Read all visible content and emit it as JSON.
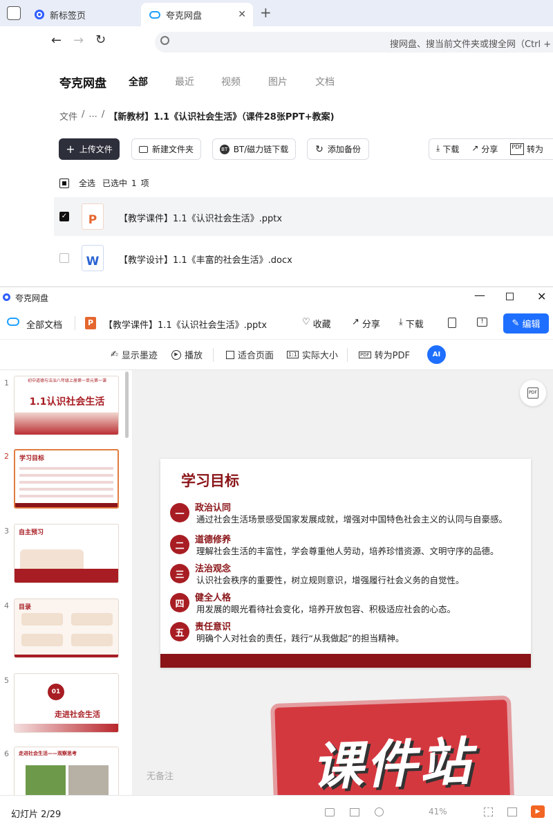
{
  "browser": {
    "tabs": [
      {
        "label": "新标签页"
      },
      {
        "label": "夸克网盘"
      }
    ],
    "new_tab_symbol": "+",
    "close_symbol": "✕",
    "address_placeholder": "搜网盘、搜当前文件夹或搜全网（Ctrl + F"
  },
  "drive": {
    "brand": "夸克网盘",
    "nav_tabs": [
      "全部",
      "最近",
      "视频",
      "图片",
      "文档"
    ],
    "breadcrumb": {
      "root": "文件",
      "sep1": "/",
      "ellipsis": "...",
      "sep2": "/",
      "current": "【新教材】1.1《认识社会生活》（课件28张PPT+教案)"
    },
    "buttons": {
      "upload": "上传文件",
      "new_folder": "新建文件夹",
      "bt": "BT/磁力链下载",
      "backup": "添加备份",
      "download": "下载",
      "share": "分享",
      "to_pdf": "转为"
    },
    "select_all": "全选",
    "selected_prefix": "已选中",
    "selected_count": "1",
    "selected_suffix": "项",
    "files": [
      {
        "name": "【教学课件】1.1《认识社会生活》.pptx",
        "type_letter": "P",
        "checked": true
      },
      {
        "name": "【教学设计】1.1《丰富的社会生活》.docx",
        "type_letter": "W",
        "checked": false
      }
    ]
  },
  "viewer": {
    "window_title": "夸克网盘",
    "all_docs": "全部文档",
    "file_name": "【教学课件】1.1《认识社会生活》.pptx",
    "file_letter": "P",
    "actions": {
      "favorite": "收藏",
      "share": "分享",
      "download": "下载",
      "edit": "编辑"
    },
    "tools": {
      "ink": "显示墨迹",
      "play": "播放",
      "fit": "适合页面",
      "actual": "实际大小",
      "pdf": "转为PDF"
    },
    "thumbnails": [
      {
        "num": "1",
        "top_text": "初中道德与法治八年级上册第一单元第一课",
        "title": "1.1认识社会生活"
      },
      {
        "num": "2",
        "title": "学习目标"
      },
      {
        "num": "3",
        "title": "自主预习"
      },
      {
        "num": "4",
        "title": "目录"
      },
      {
        "num": "5",
        "badge": "01",
        "title": "走进社会生活"
      },
      {
        "num": "6",
        "title": "走进社会生活——观察思考"
      }
    ],
    "slide": {
      "title": "学习目标",
      "objectives": [
        {
          "badge": "一",
          "title": "政治认同",
          "desc": "通过社会生活场景感受国家发展成就，增强对中国特色社会主义的认同与自豪感。"
        },
        {
          "badge": "二",
          "title": "道德修养",
          "desc": "理解社会生活的丰富性，学会尊重他人劳动，培养珍惜资源、文明守序的品德。"
        },
        {
          "badge": "三",
          "title": "法治观念",
          "desc": "认识社会秩序的重要性，树立规则意识，增强履行社会义务的自觉性。"
        },
        {
          "badge": "四",
          "title": "健全人格",
          "desc": "用发展的眼光看待社会变化，培养开放包容、积极适应社会的心态。"
        },
        {
          "badge": "五",
          "title": "责任意识",
          "desc": "明确个人对社会的责任，践行“从我做起”的担当精神。"
        }
      ]
    },
    "notes": "无备注",
    "watermark": "课件站",
    "slide_counter": "幻灯片 2/29",
    "zoom": "41%",
    "colors": {
      "accent": "#1e6fff",
      "slide_red": "#8a1418",
      "watermark": "#d4383f"
    }
  }
}
